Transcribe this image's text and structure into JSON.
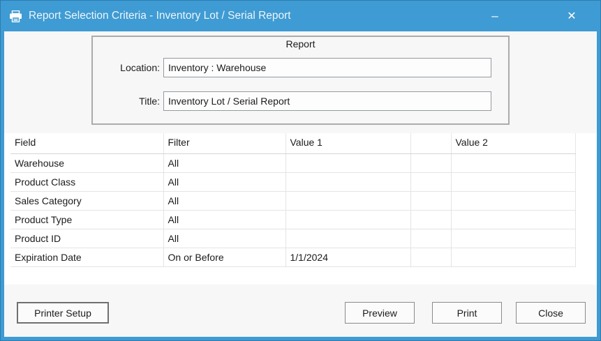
{
  "window": {
    "title": "Report Selection Criteria - Inventory Lot / Serial Report",
    "minimize_glyph": "–",
    "close_glyph": "✕"
  },
  "report_group": {
    "legend": "Report",
    "fields": [
      {
        "label": "Location:",
        "value": "Inventory : Warehouse"
      },
      {
        "label": "Title:",
        "value": "Inventory Lot / Serial Report"
      }
    ]
  },
  "criteria_table": {
    "columns": [
      "Field",
      "Filter",
      "Value 1",
      "",
      "Value 2"
    ],
    "rows": [
      {
        "field": "Warehouse",
        "filter": "All",
        "value1": "",
        "spacer": "",
        "value2": ""
      },
      {
        "field": "Product Class",
        "filter": "All",
        "value1": "",
        "spacer": "",
        "value2": ""
      },
      {
        "field": "Sales Category",
        "filter": "All",
        "value1": "",
        "spacer": "",
        "value2": ""
      },
      {
        "field": "Product Type",
        "filter": "All",
        "value1": "",
        "spacer": "",
        "value2": ""
      },
      {
        "field": "Product ID",
        "filter": "All",
        "value1": "",
        "spacer": "",
        "value2": ""
      },
      {
        "field": "Expiration Date",
        "filter": "On or Before",
        "value1": "1/1/2024",
        "spacer": "",
        "value2": ""
      }
    ]
  },
  "buttons": {
    "printer_setup": "Printer Setup",
    "preview": "Preview",
    "print": "Print",
    "close": "Close"
  },
  "colors": {
    "titlebar_blue": "#3f9bd3",
    "border_dark_blue": "#2c7cad",
    "body_gray": "#f7f7f8",
    "table_white": "#ffffff",
    "grid_line": "#e4e4e5",
    "groupbox_border": "#ababab",
    "text": "#1b1b1b"
  }
}
